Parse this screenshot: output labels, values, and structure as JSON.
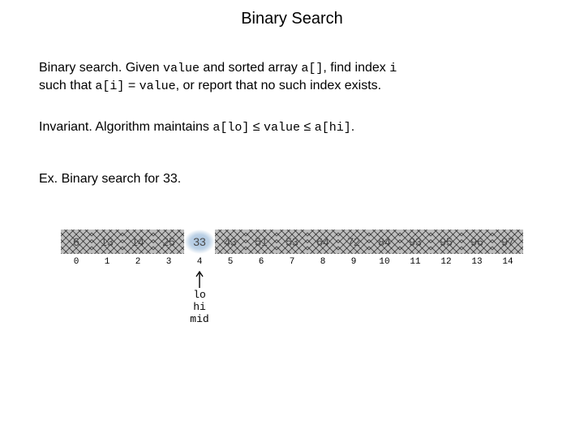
{
  "title": "Binary Search",
  "para1": {
    "lead": "Binary search.",
    "t1": "  Given ",
    "c1": "value",
    "t2": " and sorted array ",
    "c2": "a[]",
    "t3": ", find index ",
    "c3": "i",
    "t4": "such that ",
    "c4": "a[i]",
    "t5": " = ",
    "c5": "value",
    "t6": ", or report that no such index exists."
  },
  "para2": {
    "lead": "Invariant.",
    "t1": "  Algorithm maintains ",
    "c1": "a[lo]",
    "le1": " ≤ ",
    "c2": "value",
    "le2": " ≤ ",
    "c3": "a[hi]",
    "dot": "."
  },
  "para3": {
    "lead": "Ex.",
    "t1": "  Binary search for 33."
  },
  "array": {
    "values": [
      "6",
      "13",
      "14",
      "25",
      "33",
      "43",
      "51",
      "53",
      "64",
      "72",
      "84",
      "93",
      "95",
      "96",
      "97"
    ],
    "indices": [
      "0",
      "1",
      "2",
      "3",
      "4",
      "5",
      "6",
      "7",
      "8",
      "9",
      "10",
      "11",
      "12",
      "13",
      "14"
    ],
    "highlightIndex": 4,
    "pointer": {
      "index": 4,
      "labels": [
        "lo",
        "hi",
        "mid"
      ]
    }
  }
}
